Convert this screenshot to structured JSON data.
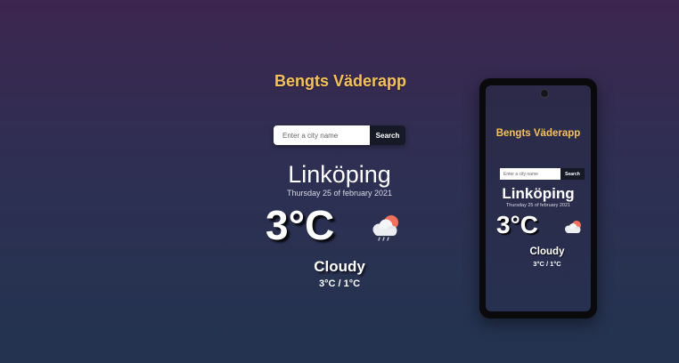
{
  "app": {
    "title": "Bengts Väderapp"
  },
  "search": {
    "placeholder": "Enter a city name",
    "button_label": "Search"
  },
  "weather": {
    "city": "Linköping",
    "date": "Thursday 25 of february 2021",
    "temperature": "3°C",
    "condition": "Cloudy",
    "range": "3°C / 1°C",
    "icon": "cloud-rain-sun-icon"
  },
  "phone": {
    "title": "Bengts Väderapp",
    "search_placeholder": "Enter a city name",
    "search_button_label": "Search",
    "city": "Linköping",
    "date": "Thursday 25 of february 2021",
    "temperature": "3°C",
    "condition": "Cloudy",
    "range": "3°C / 1°C",
    "icon": "cloud-sun-icon"
  },
  "colors": {
    "accent": "#f5c15a",
    "background_top": "#3d2650",
    "background_bottom": "#233450",
    "button": "#161a27",
    "sun": "#f2705c"
  }
}
